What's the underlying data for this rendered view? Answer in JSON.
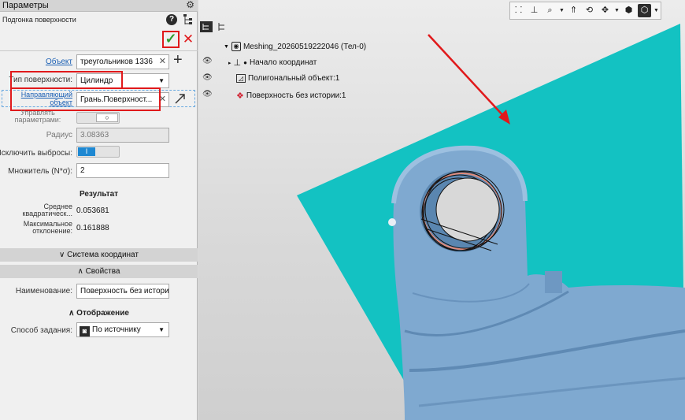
{
  "panel": {
    "title": "Параметры",
    "command_name": "Подгонка поверхности",
    "help_icon": "?",
    "ok_icon": "✓",
    "cancel_icon": "✕",
    "object_label": "Объект",
    "object_value": "треугольников 1336",
    "add_icon": "+",
    "surface_type_label": "Тип поверхности:",
    "surface_type_value": "Цилиндр",
    "direction_label_1": "Направляющий",
    "direction_label_2": "объект",
    "direction_value": "Грань.Поверхност...",
    "params_label_1": "Управлять",
    "params_label_2": "параметрами:",
    "radius_label": "Радиус",
    "radius_value": "3.08363",
    "outliers_label": "Исключить выбросы:",
    "outliers_knob": "I",
    "multiplier_label": "Множитель (N*σ):",
    "multiplier_value": "2",
    "result_heading": "Результат",
    "rms_label_1": "Среднее",
    "rms_label_2": "квадратическ...",
    "rms_value": "0.053681",
    "max_dev_label_1": "Максимальное",
    "max_dev_label_2": "отклонение:",
    "max_dev_value": "0.161888",
    "coord_system_section": "∨ Система координат",
    "properties_section": "∧ Свойства",
    "name_label": "Наименование:",
    "name_value": "Поверхность без истории",
    "display_heading": "∧ Отображение",
    "method_label": "Способ задания:",
    "method_value": "По источнику"
  },
  "tree": {
    "root": "Meshing_20260519222046 (Тел-0)",
    "items": [
      {
        "label": "Начало координат"
      },
      {
        "label": "Полигональный объект:1"
      },
      {
        "label": "Поверхность без истории:1"
      }
    ]
  },
  "colors": {
    "accent_red": "#e0191b",
    "ok_green": "#2e9d2e",
    "plane_cyan": "#13c2c2",
    "mesh_blue": "#7fa9d0",
    "link_blue": "#1a5fb4"
  }
}
